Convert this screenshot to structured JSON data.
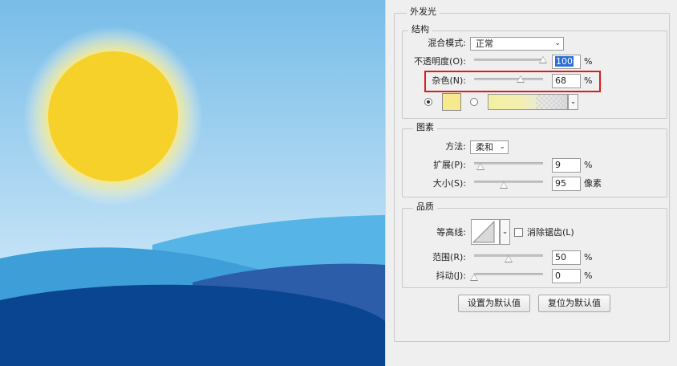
{
  "section_title": "外发光",
  "structure": {
    "legend": "结构",
    "blend_mode": {
      "label": "混合模式:",
      "value": "正常"
    },
    "opacity": {
      "label": "不透明度(O):",
      "value": "100",
      "unit": "%",
      "level": 100
    },
    "noise": {
      "label": "杂色(N):",
      "value": "68",
      "unit": "%",
      "level": 68
    },
    "color_swatch": "#f7ea8e"
  },
  "elements": {
    "legend": "图素",
    "technique": {
      "label": "方法:",
      "value": "柔和"
    },
    "spread": {
      "label": "扩展(P):",
      "value": "9",
      "unit": "%",
      "level": 9
    },
    "size": {
      "label": "大小(S):",
      "value": "95",
      "unit": "像素"
    }
  },
  "quality": {
    "legend": "品质",
    "contour_label": "等高线:",
    "anti_alias": {
      "label": "消除锯齿(L)",
      "checked": false
    },
    "range": {
      "label": "范围(R):",
      "value": "50",
      "unit": "%",
      "level": 50
    },
    "jitter": {
      "label": "抖动(J):",
      "value": "0",
      "unit": "%",
      "level": 0
    }
  },
  "buttons": {
    "make_default": "设置为默认值",
    "reset_default": "复位为默认值"
  },
  "colors": {
    "highlight": "#d81e1e",
    "sun": "#f6d12a",
    "sky_top": "#7ec0e8",
    "sky_bottom": "#d8eefa"
  }
}
